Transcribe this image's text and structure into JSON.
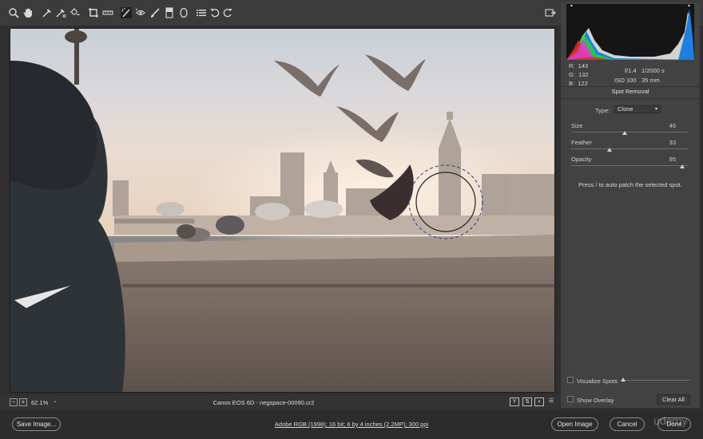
{
  "toolbar": {
    "tools": [
      "zoom-icon",
      "hand-icon",
      "white-balance-icon",
      "color-sampler-icon",
      "target-adjust-icon",
      "crop-icon",
      "straighten-icon",
      "spot-removal-icon",
      "red-eye-icon",
      "adjustment-brush-icon",
      "graduated-filter-icon",
      "radial-filter-icon",
      "list-icon",
      "rotate-ccw-icon",
      "rotate-cw-icon"
    ],
    "active_tool": "spot-removal-icon"
  },
  "readouts": {
    "r": "R:",
    "r_val": "143",
    "g": "G:",
    "g_val": "132",
    "b": "B:",
    "b_val": "122",
    "aperture": "f/1.4",
    "shutter": "1/2000 s",
    "iso": "ISO 100",
    "focal": "35 mm"
  },
  "panel": {
    "title": "Spot Removal",
    "type_label": "Type:",
    "type_value": "Clone",
    "sliders": [
      {
        "label": "Size",
        "value": "46",
        "fraction": 0.46
      },
      {
        "label": "Feather",
        "value": "33",
        "fraction": 0.33
      },
      {
        "label": "Opacity",
        "value": "95",
        "fraction": 0.95
      }
    ],
    "hint": "Press / to auto patch the selected spot.",
    "visualize_spots": "Visualize Spots",
    "show_overlay": "Show Overlay",
    "clear_all": "Clear All"
  },
  "statusbar": {
    "zoom_minus": "−",
    "zoom_plus": "+",
    "zoom": "62.1%",
    "caption": "Canon EOS 6D  -  negspace-00090.cr2",
    "y_label": "Y"
  },
  "bottombar": {
    "save": "Save Image...",
    "workflow": "Adobe RGB (1998); 16 bit; 6 by 4 inches (2.2MP); 300 ppi",
    "open": "Open Image",
    "cancel": "Cancel",
    "done": "Done",
    "watermark": "udemy"
  },
  "colors": {
    "accent": "#d8d8d8",
    "panel": "#424242",
    "background": "#2f2f2f"
  }
}
